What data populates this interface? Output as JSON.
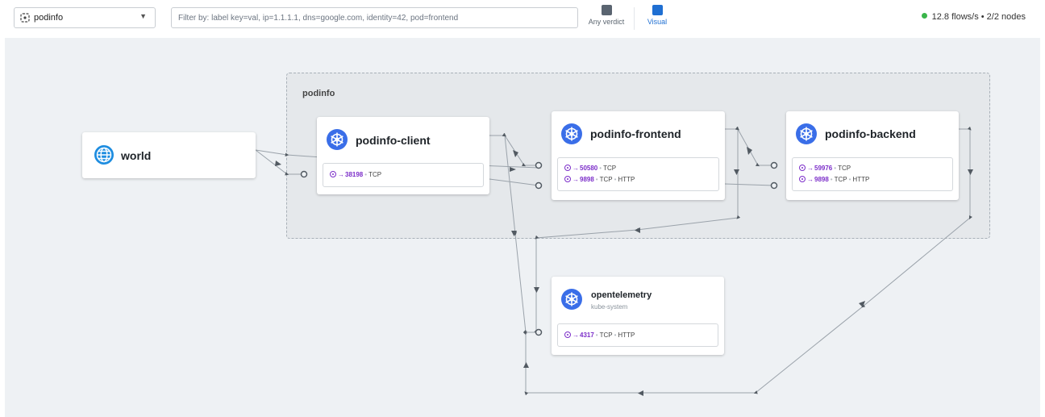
{
  "toolbar": {
    "namespace": "podinfo",
    "filter_placeholder": "Filter by: label key=val, ip=1.1.1.1, dns=google.com, identity=42, pod=frontend",
    "verdict_label": "Any verdict",
    "visual_label": "Visual",
    "status_text": "12.8 flows/s • 2/2 nodes",
    "status_color": "#3ab54a"
  },
  "canvas": {
    "namespace_title": "podinfo",
    "cards": {
      "world": {
        "name": "world"
      },
      "client": {
        "name": "podinfo-client",
        "ports": [
          {
            "port": "38198",
            "protocols": [
              "TCP"
            ]
          }
        ]
      },
      "frontend": {
        "name": "podinfo-frontend",
        "ports": [
          {
            "port": "50580",
            "protocols": [
              "TCP"
            ]
          },
          {
            "port": "9898",
            "protocols": [
              "TCP",
              "HTTP"
            ]
          }
        ]
      },
      "backend": {
        "name": "podinfo-backend",
        "ports": [
          {
            "port": "59976",
            "protocols": [
              "TCP"
            ]
          },
          {
            "port": "9898",
            "protocols": [
              "TCP",
              "HTTP"
            ]
          }
        ]
      },
      "otel": {
        "name": "opentelemetry",
        "namespace": "kube-system",
        "ports": [
          {
            "port": "4317",
            "protocols": [
              "TCP",
              "HTTP"
            ]
          }
        ]
      }
    }
  },
  "colors": {
    "accent": "#1f6fd2",
    "port": "#7c2ec9",
    "k8s_icon": "#3a6ee8",
    "edge": "#9aa2aa"
  },
  "icons": {
    "namespace": "namespace-icon",
    "dropdown": "chevron-down-icon",
    "verdict": "verdict-icon",
    "visual": "visual-icon",
    "world": "globe-icon",
    "workload": "kubernetes-icon",
    "port": "port-target-icon"
  }
}
